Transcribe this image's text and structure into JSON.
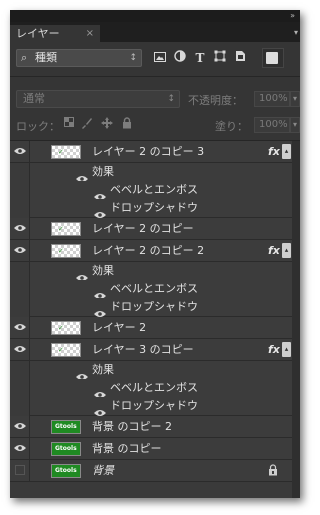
{
  "panel": {
    "collapse_glyph": "»",
    "tab_label": "レイヤー",
    "tab_close": "×",
    "menu_glyph": "▾"
  },
  "filter": {
    "search_icon": "⌕",
    "kind_label": "種類",
    "arrow": "↕",
    "icons": [
      "image-filter-icon",
      "adjustment-filter-icon",
      "type-filter-icon",
      "shape-filter-icon",
      "smartobject-filter-icon"
    ],
    "type_glyph": "T"
  },
  "blend": {
    "mode": "通常",
    "arrow": "↕",
    "opacity_label": "不透明度：",
    "opacity_value": "100%",
    "lock_label": "ロック：",
    "fill_label": "塗り：",
    "fill_value": "100%",
    "dropdown_glyph": "▾"
  },
  "layers": [
    {
      "name": "レイヤー 2 のコピー 3",
      "thumb": "checker",
      "fx": true
    },
    {
      "name": "レイヤー 2 のコピー",
      "thumb": "checker",
      "fx": false
    },
    {
      "name": "レイヤー 2 のコピー 2",
      "thumb": "checker",
      "fx": true
    },
    {
      "name": "レイヤー 2",
      "thumb": "checker",
      "fx": false
    },
    {
      "name": "レイヤー 3 のコピー",
      "thumb": "checker",
      "fx": true
    },
    {
      "name": "背景 のコピー 2",
      "thumb": "green",
      "fx": false
    },
    {
      "name": "背景 のコピー",
      "thumb": "green",
      "fx": false
    },
    {
      "name": "背景",
      "thumb": "green",
      "fx": false,
      "locked": true,
      "hidden": true
    }
  ],
  "effects": {
    "group_label": "効果",
    "bevel": "ベベルとエンボス",
    "drop_shadow": "ドロップシャドウ"
  },
  "fx_label": "fx",
  "fx_arrow": "▴",
  "thumb_text": {
    "checker": "✓",
    "green": "Gtools"
  },
  "lock_glyph": "☖",
  "colors": {
    "panel_bg": "#353535",
    "layer_bg": "#3c3c3c",
    "thumb_green": "#1f8a22"
  }
}
